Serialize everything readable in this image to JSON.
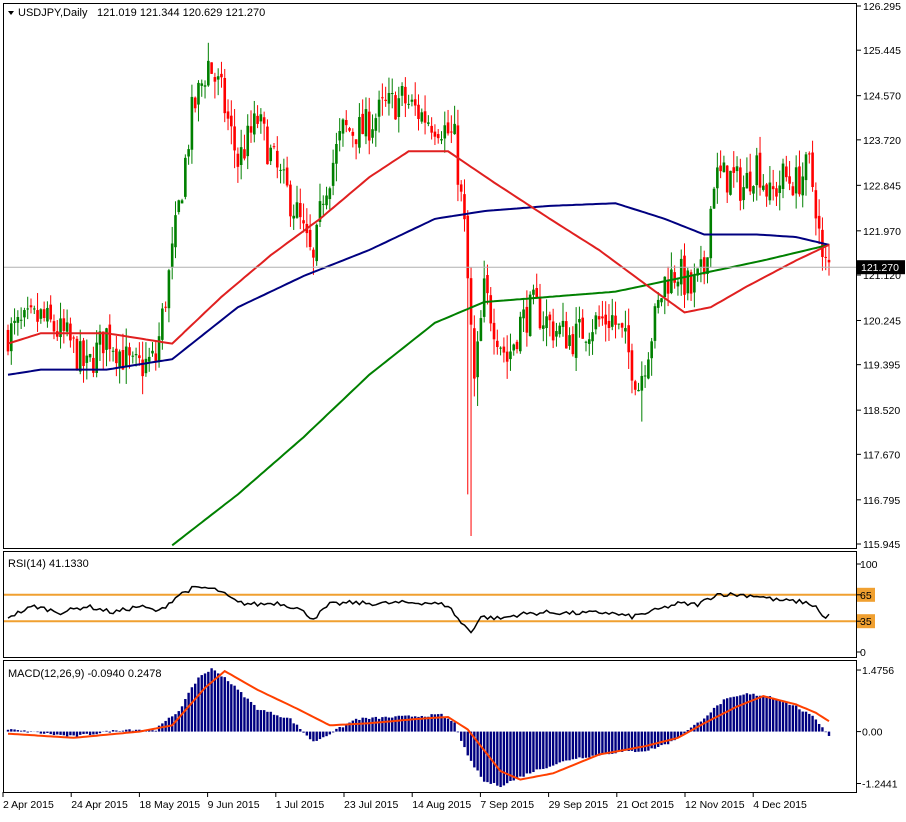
{
  "chart_data": {
    "type": "candlestick",
    "main": {
      "title": "USDJPY,Daily",
      "ohlc_header": "121.019 121.344 120.629 121.270",
      "y_ticks": [
        "126.295",
        "125.445",
        "124.570",
        "123.720",
        "122.845",
        "121.970",
        "121.120",
        "120.245",
        "119.395",
        "118.520",
        "117.670",
        "116.795",
        "115.945"
      ],
      "ylim": [
        115.945,
        126.295
      ],
      "last_price": "121.270",
      "x_ticks": [
        "2 Apr 2015",
        "24 Apr 2015",
        "18 May 2015",
        "9 Jun 2015",
        "1 Jul 2015",
        "23 Jul 2015",
        "14 Aug 2015",
        "7 Sep 2015",
        "29 Sep 2015",
        "21 Oct 2015",
        "12 Nov 2015",
        "4 Dec 2015"
      ],
      "colors": {
        "bull": "#008000",
        "bear": "#ff0000",
        "ma_fast": "#e02020",
        "ma_mid": "#000080",
        "ma_slow": "#008000"
      },
      "path_knots": [
        {
          "i": 0,
          "v": 120.0
        },
        {
          "i": 10,
          "v": 120.3
        },
        {
          "i": 18,
          "v": 119.9
        },
        {
          "i": 24,
          "v": 119.3
        },
        {
          "i": 30,
          "v": 120.0
        },
        {
          "i": 38,
          "v": 119.3
        },
        {
          "i": 45,
          "v": 119.5
        },
        {
          "i": 50,
          "v": 121.5
        },
        {
          "i": 56,
          "v": 124.2
        },
        {
          "i": 61,
          "v": 125.2
        },
        {
          "i": 65,
          "v": 124.6
        },
        {
          "i": 70,
          "v": 123.3
        },
        {
          "i": 76,
          "v": 124.1
        },
        {
          "i": 82,
          "v": 123.1
        },
        {
          "i": 88,
          "v": 122.3
        },
        {
          "i": 93,
          "v": 121.3
        },
        {
          "i": 96,
          "v": 122.7
        },
        {
          "i": 102,
          "v": 123.9
        },
        {
          "i": 108,
          "v": 123.9
        },
        {
          "i": 114,
          "v": 124.3
        },
        {
          "i": 120,
          "v": 124.5
        },
        {
          "i": 126,
          "v": 124.2
        },
        {
          "i": 132,
          "v": 124.0
        },
        {
          "i": 136,
          "v": 123.7
        },
        {
          "i": 139,
          "v": 122.0
        },
        {
          "i": 142,
          "v": 119.0
        },
        {
          "i": 145,
          "v": 120.8
        },
        {
          "i": 148,
          "v": 120.2
        },
        {
          "i": 152,
          "v": 119.5
        },
        {
          "i": 156,
          "v": 120.2
        },
        {
          "i": 160,
          "v": 120.5
        },
        {
          "i": 166,
          "v": 120.1
        },
        {
          "i": 172,
          "v": 119.9
        },
        {
          "i": 178,
          "v": 120.2
        },
        {
          "i": 184,
          "v": 120.3
        },
        {
          "i": 188,
          "v": 119.8
        },
        {
          "i": 192,
          "v": 119.0
        },
        {
          "i": 196,
          "v": 120.0
        },
        {
          "i": 200,
          "v": 121.0
        },
        {
          "i": 204,
          "v": 121.2
        },
        {
          "i": 208,
          "v": 120.8
        },
        {
          "i": 212,
          "v": 121.2
        },
        {
          "i": 215,
          "v": 123.0
        },
        {
          "i": 220,
          "v": 123.0
        },
        {
          "i": 224,
          "v": 122.8
        },
        {
          "i": 228,
          "v": 123.3
        },
        {
          "i": 232,
          "v": 122.6
        },
        {
          "i": 236,
          "v": 123.0
        },
        {
          "i": 240,
          "v": 122.9
        },
        {
          "i": 244,
          "v": 123.2
        },
        {
          "i": 246,
          "v": 122.5
        },
        {
          "i": 248,
          "v": 121.3
        },
        {
          "i": 250,
          "v": 121.3
        }
      ],
      "spike_knots": [
        {
          "i": 141,
          "v": 116.1
        },
        {
          "i": 140,
          "v": 116.9
        },
        {
          "i": 193,
          "v": 118.3
        },
        {
          "i": 143,
          "v": 118.6
        }
      ],
      "ma_fast_knots": [
        {
          "i": 0,
          "v": 119.8
        },
        {
          "i": 10,
          "v": 120.0
        },
        {
          "i": 30,
          "v": 120.0
        },
        {
          "i": 50,
          "v": 119.8
        },
        {
          "i": 65,
          "v": 120.7
        },
        {
          "i": 80,
          "v": 121.5
        },
        {
          "i": 95,
          "v": 122.2
        },
        {
          "i": 110,
          "v": 123.0
        },
        {
          "i": 122,
          "v": 123.5
        },
        {
          "i": 134,
          "v": 123.5
        },
        {
          "i": 148,
          "v": 122.9
        },
        {
          "i": 165,
          "v": 122.2
        },
        {
          "i": 180,
          "v": 121.6
        },
        {
          "i": 195,
          "v": 120.9
        },
        {
          "i": 206,
          "v": 120.4
        },
        {
          "i": 214,
          "v": 120.5
        },
        {
          "i": 225,
          "v": 120.9
        },
        {
          "i": 240,
          "v": 121.4
        },
        {
          "i": 250,
          "v": 121.7
        }
      ],
      "ma_mid_knots": [
        {
          "i": 0,
          "v": 119.2
        },
        {
          "i": 10,
          "v": 119.3
        },
        {
          "i": 30,
          "v": 119.3
        },
        {
          "i": 50,
          "v": 119.5
        },
        {
          "i": 70,
          "v": 120.5
        },
        {
          "i": 90,
          "v": 121.1
        },
        {
          "i": 110,
          "v": 121.6
        },
        {
          "i": 130,
          "v": 122.2
        },
        {
          "i": 145,
          "v": 122.35
        },
        {
          "i": 165,
          "v": 122.45
        },
        {
          "i": 185,
          "v": 122.5
        },
        {
          "i": 200,
          "v": 122.2
        },
        {
          "i": 212,
          "v": 121.9
        },
        {
          "i": 228,
          "v": 121.9
        },
        {
          "i": 240,
          "v": 121.85
        },
        {
          "i": 250,
          "v": 121.7
        }
      ],
      "ma_slow_knots": [
        {
          "i": 50,
          "v": 115.92
        },
        {
          "i": 70,
          "v": 116.9
        },
        {
          "i": 90,
          "v": 118.0
        },
        {
          "i": 110,
          "v": 119.2
        },
        {
          "i": 130,
          "v": 120.2
        },
        {
          "i": 145,
          "v": 120.6
        },
        {
          "i": 165,
          "v": 120.7
        },
        {
          "i": 185,
          "v": 120.8
        },
        {
          "i": 200,
          "v": 121.0
        },
        {
          "i": 215,
          "v": 121.2
        },
        {
          "i": 230,
          "v": 121.4
        },
        {
          "i": 250,
          "v": 121.7
        }
      ]
    },
    "rsi": {
      "title": "RSI(14) 41.1330",
      "y_ticks": [
        "100",
        "65",
        "35",
        "0"
      ],
      "ylim": [
        0,
        100
      ],
      "levels": [
        65,
        35
      ],
      "level_color": "#f0a030",
      "knots": [
        {
          "i": 0,
          "v": 40
        },
        {
          "i": 8,
          "v": 52
        },
        {
          "i": 16,
          "v": 45
        },
        {
          "i": 24,
          "v": 52
        },
        {
          "i": 32,
          "v": 45
        },
        {
          "i": 40,
          "v": 52
        },
        {
          "i": 46,
          "v": 46
        },
        {
          "i": 52,
          "v": 65
        },
        {
          "i": 56,
          "v": 72
        },
        {
          "i": 60,
          "v": 73
        },
        {
          "i": 64,
          "v": 70
        },
        {
          "i": 70,
          "v": 56
        },
        {
          "i": 76,
          "v": 54
        },
        {
          "i": 82,
          "v": 56
        },
        {
          "i": 88,
          "v": 50
        },
        {
          "i": 93,
          "v": 38
        },
        {
          "i": 98,
          "v": 54
        },
        {
          "i": 104,
          "v": 56
        },
        {
          "i": 112,
          "v": 55
        },
        {
          "i": 120,
          "v": 56
        },
        {
          "i": 128,
          "v": 56
        },
        {
          "i": 134,
          "v": 53
        },
        {
          "i": 138,
          "v": 33
        },
        {
          "i": 141,
          "v": 23
        },
        {
          "i": 144,
          "v": 40
        },
        {
          "i": 150,
          "v": 38
        },
        {
          "i": 156,
          "v": 43
        },
        {
          "i": 164,
          "v": 45
        },
        {
          "i": 174,
          "v": 44
        },
        {
          "i": 182,
          "v": 45
        },
        {
          "i": 190,
          "v": 40
        },
        {
          "i": 196,
          "v": 46
        },
        {
          "i": 204,
          "v": 55
        },
        {
          "i": 210,
          "v": 54
        },
        {
          "i": 216,
          "v": 66
        },
        {
          "i": 222,
          "v": 65
        },
        {
          "i": 228,
          "v": 64
        },
        {
          "i": 234,
          "v": 59
        },
        {
          "i": 242,
          "v": 57
        },
        {
          "i": 246,
          "v": 52
        },
        {
          "i": 248,
          "v": 40
        },
        {
          "i": 250,
          "v": 41
        }
      ]
    },
    "macd": {
      "title": "MACD(12,26,9) -0.0940 0.2478",
      "y_ticks": [
        "1.4756",
        "0.00",
        "-1.2441"
      ],
      "ylim": [
        -1.4,
        1.62
      ],
      "hist_color": "#000080",
      "signal_color": "#ff4000",
      "hist_knots": [
        {
          "i": 0,
          "v": 0.05
        },
        {
          "i": 20,
          "v": -0.12
        },
        {
          "i": 35,
          "v": 0.05
        },
        {
          "i": 45,
          "v": 0.05
        },
        {
          "i": 52,
          "v": 0.5
        },
        {
          "i": 58,
          "v": 1.3
        },
        {
          "i": 62,
          "v": 1.5
        },
        {
          "i": 66,
          "v": 1.3
        },
        {
          "i": 76,
          "v": 0.55
        },
        {
          "i": 86,
          "v": 0.3
        },
        {
          "i": 93,
          "v": -0.25
        },
        {
          "i": 98,
          "v": -0.05
        },
        {
          "i": 106,
          "v": 0.3
        },
        {
          "i": 118,
          "v": 0.35
        },
        {
          "i": 132,
          "v": 0.4
        },
        {
          "i": 136,
          "v": 0.2
        },
        {
          "i": 140,
          "v": -0.6
        },
        {
          "i": 145,
          "v": -1.2
        },
        {
          "i": 150,
          "v": -1.3
        },
        {
          "i": 160,
          "v": -0.95
        },
        {
          "i": 172,
          "v": -0.65
        },
        {
          "i": 185,
          "v": -0.5
        },
        {
          "i": 195,
          "v": -0.45
        },
        {
          "i": 202,
          "v": -0.25
        },
        {
          "i": 210,
          "v": 0.2
        },
        {
          "i": 218,
          "v": 0.75
        },
        {
          "i": 225,
          "v": 0.9
        },
        {
          "i": 232,
          "v": 0.85
        },
        {
          "i": 240,
          "v": 0.6
        },
        {
          "i": 246,
          "v": 0.3
        },
        {
          "i": 250,
          "v": -0.09
        }
      ],
      "signal_knots": [
        {
          "i": 0,
          "v": -0.05
        },
        {
          "i": 20,
          "v": -0.15
        },
        {
          "i": 40,
          "v": 0.0
        },
        {
          "i": 50,
          "v": 0.15
        },
        {
          "i": 60,
          "v": 1.05
        },
        {
          "i": 66,
          "v": 1.45
        },
        {
          "i": 76,
          "v": 1.0
        },
        {
          "i": 88,
          "v": 0.55
        },
        {
          "i": 98,
          "v": 0.15
        },
        {
          "i": 110,
          "v": 0.2
        },
        {
          "i": 124,
          "v": 0.3
        },
        {
          "i": 134,
          "v": 0.35
        },
        {
          "i": 140,
          "v": 0.05
        },
        {
          "i": 150,
          "v": -0.95
        },
        {
          "i": 156,
          "v": -1.15
        },
        {
          "i": 166,
          "v": -1.0
        },
        {
          "i": 180,
          "v": -0.55
        },
        {
          "i": 194,
          "v": -0.35
        },
        {
          "i": 204,
          "v": -0.15
        },
        {
          "i": 212,
          "v": 0.2
        },
        {
          "i": 222,
          "v": 0.6
        },
        {
          "i": 230,
          "v": 0.85
        },
        {
          "i": 240,
          "v": 0.65
        },
        {
          "i": 246,
          "v": 0.45
        },
        {
          "i": 250,
          "v": 0.25
        }
      ]
    }
  }
}
